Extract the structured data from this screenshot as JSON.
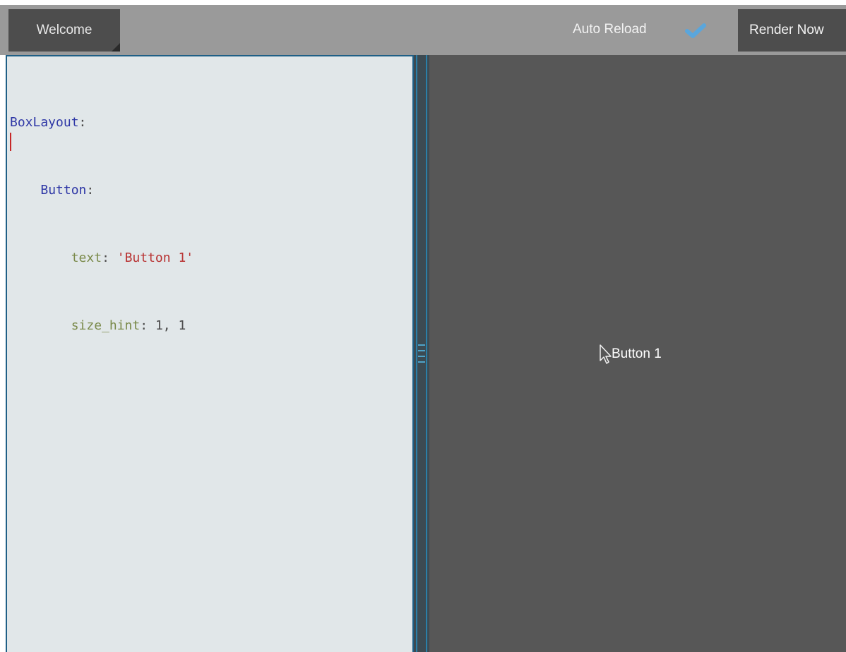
{
  "toolbar": {
    "welcome_label": "Welcome",
    "auto_reload_label": "Auto Reload",
    "auto_reload_checked": true,
    "render_now_label": "Render Now"
  },
  "editor": {
    "line1_key": "BoxLayout",
    "line1_colon": ":",
    "line2_key": "Button",
    "line2_colon": ":",
    "line3_prop": "text",
    "line3_colon": ": ",
    "line3_value": "'Button 1'",
    "line4_prop": "size_hint",
    "line4_colon": ": ",
    "line4_value": "1, 1"
  },
  "preview": {
    "button_text": "Button 1"
  },
  "colors": {
    "keyword": "#2e37a6",
    "property": "#7a8a4a",
    "string": "#b83232",
    "preview_bg": "#575757",
    "editor_bg": "#e1e7e9",
    "toolbar_bg": "#9a9a9a"
  },
  "icons": {
    "auto_reload_checkbox": "checkmark-icon",
    "mouse_cursor": "mouse-pointer-icon",
    "splitter_grip": "grip-icon"
  }
}
